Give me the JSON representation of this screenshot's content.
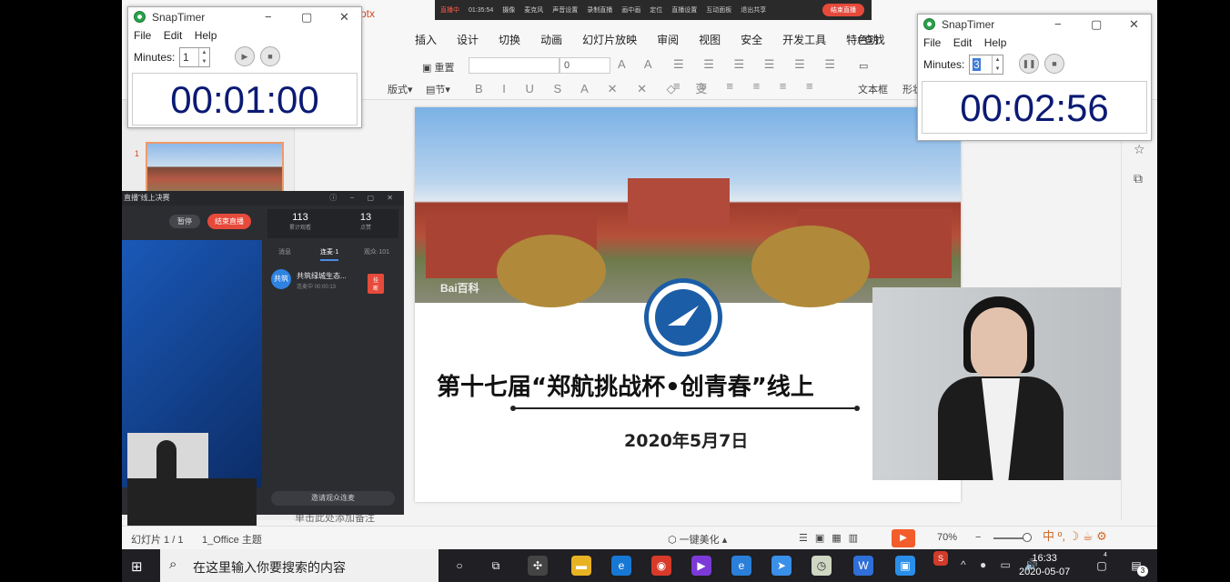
{
  "ribbon": {
    "file_title": "ptx",
    "tabs": [
      "插入",
      "设计",
      "切换",
      "动画",
      "幻灯片放映",
      "审阅",
      "视图",
      "安全",
      "开发工具",
      "特色功"
    ],
    "search": "查找",
    "tools": {
      "reset": "重置",
      "layout": "版式",
      "section": "节",
      "textbox": "文本框",
      "shape": "形状",
      "font_size": "0"
    }
  },
  "live_bar": {
    "recording": "直播中",
    "elapsed": "01:35:54",
    "items": [
      "摄像",
      "麦克风",
      "声音设置",
      "录制直播",
      "画中画",
      "定位",
      "直播设置",
      "互动面板",
      "退出共享"
    ],
    "end_label": "结束直播"
  },
  "slide_panel": {
    "slide_number": "1"
  },
  "slide": {
    "watermark": "Bai百科",
    "title": "第十七届“郑航挑战杯•创青春”线上",
    "date": "2020年5月7日"
  },
  "status_bar": {
    "slide_count": "幻灯片 1 / 1",
    "theme": "1_Office 主题",
    "beautify": "一键美化",
    "zoom": "70%",
    "notes_hint": "单击此处添加备注"
  },
  "taskbar": {
    "search_placeholder": "在这里输入你要搜索的内容",
    "time": "16:33",
    "date": "2020-05-07",
    "notification_count": "3",
    "badge_count": "4"
  },
  "live_panel": {
    "title": "直播”线上决赛",
    "pause_label": "暂停",
    "end_label": "结束直播",
    "stats": [
      {
        "value": "113",
        "label": "累计观看"
      },
      {
        "value": "13",
        "label": "点赞"
      }
    ],
    "tabs": [
      "消息",
      "连麦·1",
      "观众·101"
    ],
    "user": {
      "avatar": "共筑",
      "name": "共筑绿城生态...",
      "status": "连麦中 00:00:13",
      "hangup": "挂断"
    },
    "invite_label": "邀请观众连麦"
  },
  "snaptimer_left": {
    "app_name": "SnapTimer",
    "menu": [
      "File",
      "Edit",
      "Help"
    ],
    "minutes_label": "Minutes:",
    "minutes_value": "1",
    "display": "00:01:00"
  },
  "snaptimer_right": {
    "app_name": "SnapTimer",
    "menu": [
      "File",
      "Edit",
      "Help"
    ],
    "minutes_label": "Minutes:",
    "minutes_value": "3",
    "display": "00:02:56"
  }
}
